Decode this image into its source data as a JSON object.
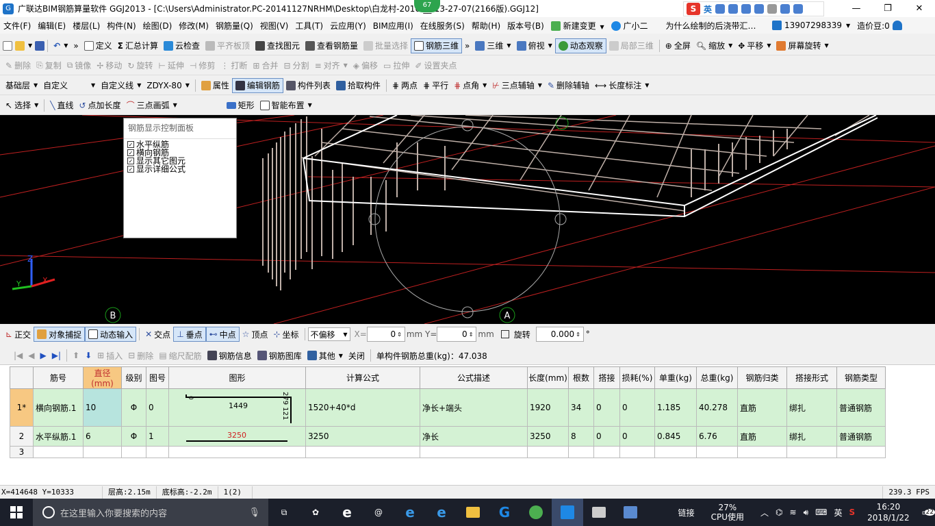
{
  "titlebar": {
    "title": "广联达BIM钢筋算量软件 GGJ2013 - [C:\\Users\\Administrator.PC-20141127NRHM\\Desktop\\白龙村-2016-__-13-27-07(2166版).GGJ12]",
    "badge": "67",
    "ime_lang": "英"
  },
  "menu": {
    "items": [
      "文件(F)",
      "编辑(E)",
      "楼层(L)",
      "构件(N)",
      "绘图(D)",
      "修改(M)",
      "钢筋量(Q)",
      "视图(V)",
      "工具(T)",
      "云应用(Y)",
      "BIM应用(I)",
      "在线服务(S)",
      "帮助(H)",
      "版本号(B)",
      "新建变更",
      "广小二",
      "为什么绘制的后浇带汇…"
    ],
    "phone": "13907298339",
    "price": "造价豆:0"
  },
  "toolbar1": {
    "items": [
      "定义",
      "汇总计算",
      "云检查",
      "平齐板顶",
      "查找图元",
      "查看钢筋量",
      "批量选择",
      "钢筋三维",
      "三维",
      "俯视",
      "动态观察",
      "局部三维",
      "全屏",
      "缩放",
      "平移",
      "屏幕旋转"
    ]
  },
  "toolbar2": {
    "items": [
      "删除",
      "复制",
      "镜像",
      "移动",
      "旋转",
      "延伸",
      "修剪",
      "打断",
      "合并",
      "分割",
      "对齐",
      "偏移",
      "拉伸",
      "设置夹点"
    ]
  },
  "toolbar3": {
    "layer": "基础层",
    "custom": "自定义",
    "custom_line": "自定义线",
    "code": "ZDYX-80",
    "items": [
      "属性",
      "编辑钢筋",
      "构件列表",
      "拾取构件",
      "两点",
      "平行",
      "点角",
      "三点辅轴",
      "删除辅轴",
      "长度标注"
    ]
  },
  "toolbar4": {
    "items": [
      "选择",
      "直线",
      "点加长度",
      "三点画弧",
      "矩形",
      "智能布置"
    ]
  },
  "control_panel": {
    "title": "钢筋显示控制面板",
    "options": [
      "水平纵筋",
      "横向钢筋",
      "显示其它图元",
      "显示详细公式"
    ]
  },
  "viewport": {
    "axis_b": "B",
    "axis_a": "A",
    "axis_x": "X",
    "axis_y": "Y",
    "axis_z": "Z"
  },
  "snapbar": {
    "items": [
      "正交",
      "对象捕捉",
      "动态输入",
      "交点",
      "垂点",
      "中点",
      "顶点",
      "坐标"
    ],
    "offset_mode": "不偏移",
    "x_label": "X=",
    "x_value": "0",
    "y_label": "mm Y=",
    "y_value": "0",
    "unit": "mm",
    "rotate_label": "旋转",
    "rotate_value": "0.000",
    "degree": "°"
  },
  "rebarbar": {
    "items": [
      "插入",
      "删除",
      "缩尺配筋",
      "钢筋信息",
      "钢筋图库",
      "其他",
      "关闭"
    ],
    "total": "单构件钢筋总重(kg)：47.038"
  },
  "table": {
    "headers": [
      "筋号",
      "直径(mm)",
      "级别",
      "图号",
      "图形",
      "计算公式",
      "公式描述",
      "长度(mm)",
      "根数",
      "搭接",
      "损耗(%)",
      "单重(kg)",
      "总重(kg)",
      "钢筋归类",
      "搭接形式",
      "钢筋类型"
    ],
    "rows": [
      {
        "idx": "1*",
        "name": "横向钢筋.1",
        "dia": "10",
        "grade": "Φ",
        "fig": "0",
        "shape_main": "1449",
        "shape_left": "0",
        "shape_right": "279 121",
        "formula": "1520+40*d",
        "desc": "净长+端头",
        "len": "1920",
        "count": "34",
        "lap": "0",
        "loss": "0",
        "unit_w": "1.185",
        "total_w": "40.278",
        "cat": "直筋",
        "lap_type": "绑扎",
        "type": "普通钢筋"
      },
      {
        "idx": "2",
        "name": "水平纵筋.1",
        "dia": "6",
        "grade": "Φ",
        "fig": "1",
        "shape_main": "3250",
        "formula": "3250",
        "desc": "净长",
        "len": "3250",
        "count": "8",
        "lap": "0",
        "loss": "0",
        "unit_w": "0.845",
        "total_w": "6.76",
        "cat": "直筋",
        "lap_type": "绑扎",
        "type": "普通钢筋"
      },
      {
        "idx": "3"
      }
    ]
  },
  "status": {
    "coords": "X=414648 Y=10333",
    "floor_h": "层高:2.15m",
    "base_h": "底标高:-2.2m",
    "count": "1(2)",
    "fps": "239.3 FPS"
  },
  "taskbar": {
    "search": "在这里输入你要搜索的内容",
    "link": "链接",
    "cpu": "27%",
    "cpu_label": "CPU使用",
    "ime": "英",
    "time": "16:20",
    "date": "2018/1/22",
    "notif": "22"
  }
}
